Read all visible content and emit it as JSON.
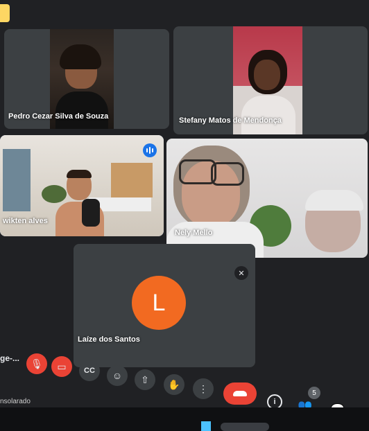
{
  "participants": {
    "p1": {
      "name": "Pedro Cezar Silva de Souza"
    },
    "p2": {
      "name": "Stefany Matos de Mendonça"
    },
    "p3": {
      "name": "wikten alves"
    },
    "p4": {
      "name": "Nely Mello"
    },
    "p5": {
      "name": "Laíze dos Santos",
      "avatar_initial": "L",
      "avatar_color": "#f26a21"
    }
  },
  "toolbar": {
    "meeting_name_truncated": "ge-...",
    "participant_count": "5"
  },
  "taskbar": {
    "weather_text": "nsolarado"
  },
  "colors": {
    "accent_blue": "#8ab4f8",
    "end_call_red": "#ea4335",
    "tile_gray": "#3c4043"
  },
  "icons": [
    "screen-share-off-icon",
    "mic-off-icon",
    "camera-off-icon",
    "captions-icon",
    "emoji-icon",
    "present-icon",
    "raise-hand-icon",
    "more-options-icon",
    "end-call-icon",
    "info-icon",
    "people-icon",
    "chat-icon",
    "activities-icon",
    "speaking-indicator-icon"
  ]
}
